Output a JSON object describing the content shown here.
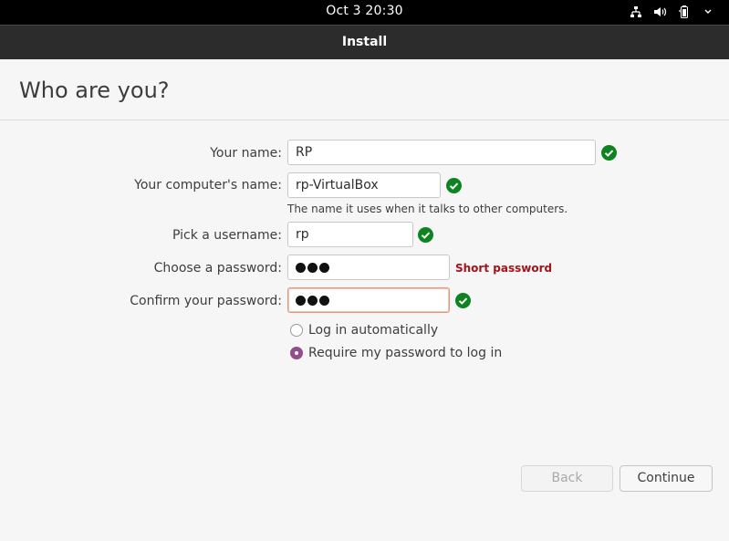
{
  "system_bar": {
    "clock": "Oct 3  20:30"
  },
  "window": {
    "title": "Install"
  },
  "page": {
    "heading": "Who are you?"
  },
  "form": {
    "name_label": "Your name:",
    "name_value": "RP",
    "computer_label": "Your computer's name:",
    "computer_value": "rp-VirtualBox",
    "computer_hint": "The name it uses when it talks to other computers.",
    "username_label": "Pick a username:",
    "username_value": "rp",
    "password_label": "Choose a password:",
    "password_strength": "Short password",
    "confirm_label": "Confirm your password:",
    "login_options": [
      {
        "label": "Log in automatically",
        "selected": false
      },
      {
        "label": "Require my password to log in",
        "selected": true
      }
    ]
  },
  "buttons": {
    "back": "Back",
    "continue": "Continue"
  },
  "colors": {
    "ok_green": "#0e8420",
    "accent_purple": "#924d8b",
    "warning_red": "#a3131b",
    "focus_orange": "#e6967a"
  }
}
